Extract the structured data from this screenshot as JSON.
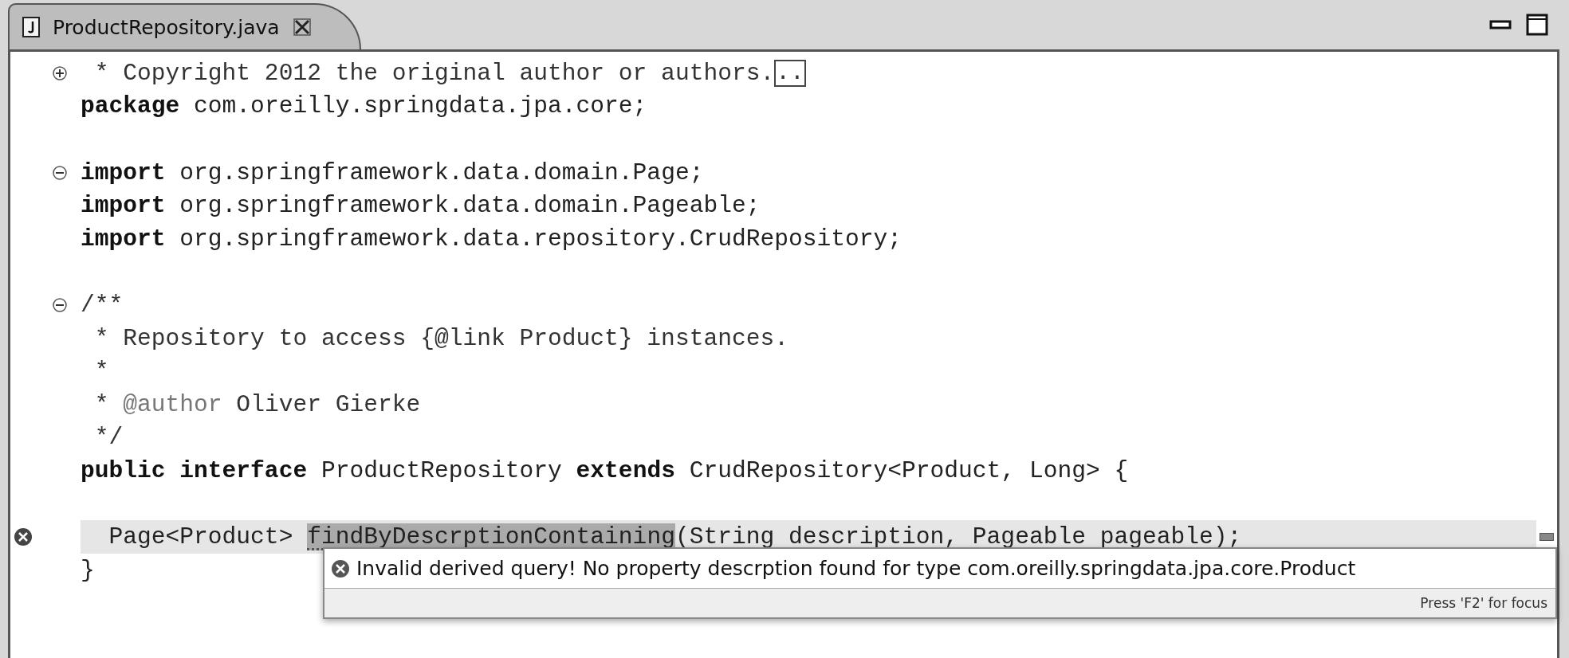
{
  "tab": {
    "title": "ProductRepository.java",
    "selected": true
  },
  "blocks": [
    {
      "lines": [
        {
          "expanded": false,
          "parts": [
            {
              "kind": "comment",
              "text": " * Copyright 2012 the original author or authors."
            },
            {
              "kind": "fold-box",
              "text": ".."
            }
          ]
        },
        {
          "parts": [
            {
              "kind": "keyword",
              "text": "package"
            },
            {
              "kind": "plain",
              "text": " com.oreilly.springdata.jpa.core;"
            }
          ]
        }
      ]
    },
    {
      "lines": [
        {
          "expanded": true,
          "parts": [
            {
              "kind": "keyword",
              "text": "import"
            },
            {
              "kind": "plain",
              "text": " org.springframework.data.domain.Page;"
            }
          ]
        },
        {
          "parts": [
            {
              "kind": "keyword",
              "text": "import"
            },
            {
              "kind": "plain",
              "text": " org.springframework.data.domain.Pageable;"
            }
          ]
        },
        {
          "parts": [
            {
              "kind": "keyword",
              "text": "import"
            },
            {
              "kind": "plain",
              "text": " org.springframework.data.repository.CrudRepository;"
            }
          ]
        }
      ]
    },
    {
      "lines": [
        {
          "expanded": true,
          "parts": [
            {
              "kind": "comment",
              "text": "/**"
            }
          ]
        },
        {
          "parts": [
            {
              "kind": "comment",
              "text": " * Repository to access {@link Product} instances."
            }
          ]
        },
        {
          "parts": [
            {
              "kind": "comment",
              "text": " *"
            }
          ]
        },
        {
          "parts": [
            {
              "kind": "comment",
              "text": " * "
            },
            {
              "kind": "annotation",
              "text": "@author"
            },
            {
              "kind": "comment",
              "text": " Oliver Gierke"
            }
          ]
        },
        {
          "parts": [
            {
              "kind": "comment",
              "text": " */"
            }
          ]
        },
        {
          "parts": [
            {
              "kind": "keyword",
              "text": "public interface"
            },
            {
              "kind": "plain",
              "text": " ProductRepository "
            },
            {
              "kind": "keyword",
              "text": "extends"
            },
            {
              "kind": "plain",
              "text": " CrudRepository<Product, Long> {"
            }
          ]
        }
      ]
    },
    {
      "lines": [
        {
          "error": true,
          "current": true,
          "parts": [
            {
              "kind": "plain",
              "text": "  Page<Product> "
            },
            {
              "kind": "error-selected",
              "text": "findByDescrptionContaining"
            },
            {
              "kind": "error",
              "text": "(String description, Pageable pageable);"
            }
          ]
        },
        {
          "parts": [
            {
              "kind": "plain",
              "text": "}"
            }
          ]
        }
      ]
    }
  ],
  "hover": {
    "message": "Invalid derived query! No property descrption found for type com.oreilly.springdata.jpa.core.Product",
    "footer": "Press 'F2' for focus"
  }
}
